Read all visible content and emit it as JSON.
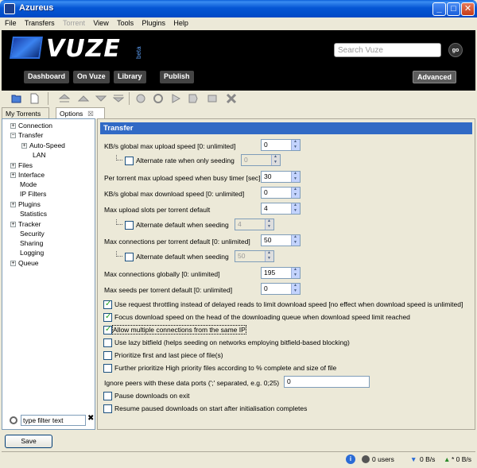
{
  "window": {
    "title": "Azureus",
    "minimize": "_",
    "maximize": "□",
    "close": "✕"
  },
  "menu": [
    "File",
    "Transfers",
    "Torrent",
    "View",
    "Tools",
    "Plugins",
    "Help"
  ],
  "menu_disabled": [
    "Torrent"
  ],
  "header": {
    "logo": "VUZE",
    "logo_tag": "beta",
    "search_placeholder": "Search Vuze",
    "go_label": "go",
    "nav": [
      "Dashboard",
      "On Vuze",
      "Library",
      "Publish"
    ],
    "advanced": "Advanced"
  },
  "tabs": [
    {
      "label": "My Torrents"
    },
    {
      "label": "Options",
      "close": "☒"
    }
  ],
  "tree": {
    "items": [
      {
        "label": "Connection",
        "pm": "+"
      },
      {
        "label": "Transfer",
        "pm": "−"
      },
      {
        "label": "Auto-Speed",
        "pm": "+"
      },
      {
        "label": "LAN",
        "pm": ""
      },
      {
        "label": "Files",
        "pm": "+"
      },
      {
        "label": "Interface",
        "pm": "+"
      },
      {
        "label": "Mode",
        "pm": ""
      },
      {
        "label": "IP Filters",
        "pm": ""
      },
      {
        "label": "Plugins",
        "pm": "+"
      },
      {
        "label": "Statistics",
        "pm": ""
      },
      {
        "label": "Tracker",
        "pm": "+"
      },
      {
        "label": "Security",
        "pm": ""
      },
      {
        "label": "Sharing",
        "pm": ""
      },
      {
        "label": "Logging",
        "pm": ""
      },
      {
        "label": "Queue",
        "pm": "+"
      }
    ],
    "filter_value": "type filter text",
    "filter_clear": "✖"
  },
  "main": {
    "title": "Transfer",
    "settings": {
      "upload_speed": {
        "label": "KB/s global max upload speed [0: unlimited]",
        "value": "0"
      },
      "alt_rate_seeding": {
        "label": "Alternate rate when only seeding",
        "value": "0",
        "checked": false
      },
      "per_torrent_busy": {
        "label": "Per torrent max upload speed when busy timer [sec]",
        "value": "30"
      },
      "download_speed": {
        "label": "KB/s global max download speed [0: unlimited]",
        "value": "0"
      },
      "upload_slots": {
        "label": "Max upload slots per torrent default",
        "value": "4"
      },
      "alt_slots_seeding": {
        "label": "Alternate default when seeding",
        "value": "4",
        "checked": false
      },
      "max_conn_torrent": {
        "label": "Max connections per torrent default [0: unlimited]",
        "value": "50"
      },
      "alt_conn_seeding": {
        "label": "Alternate default when seeding",
        "value": "50",
        "checked": false
      },
      "max_conn_global": {
        "label": "Max connections globally [0: unlimited]",
        "value": "195"
      },
      "max_seeds": {
        "label": "Max seeds per torrent default [0: unlimited]",
        "value": "0"
      }
    },
    "checkboxes": [
      {
        "label": "Use request throttling instead of delayed reads to limit download speed [no effect when download speed is unlimited]",
        "checked": true
      },
      {
        "label": "Focus download speed on the head of the downloading queue when download speed limit reached",
        "checked": true
      },
      {
        "label": "Allow multiple connections from the same IP",
        "checked": true
      },
      {
        "label": "Use lazy bitfield (helps seeding on networks employing bitfield-based blocking)",
        "checked": false
      },
      {
        "label": "Prioritize first and last piece of file(s)",
        "checked": false
      },
      {
        "label": "Further prioritize High priority files according to % complete and size of file",
        "checked": false
      }
    ],
    "ignore_ports": {
      "label": "Ignore peers with these data ports (';' separated, e.g. 0;25)",
      "value": "0"
    },
    "checkboxes2": [
      {
        "label": "Pause downloads on exit",
        "checked": false
      },
      {
        "label": "Resume paused downloads on start after initialisation completes",
        "checked": false
      }
    ]
  },
  "save_label": "Save",
  "status": {
    "info": "i",
    "users": "0 users",
    "down": "0 B/s",
    "up": "* 0 B/s"
  }
}
